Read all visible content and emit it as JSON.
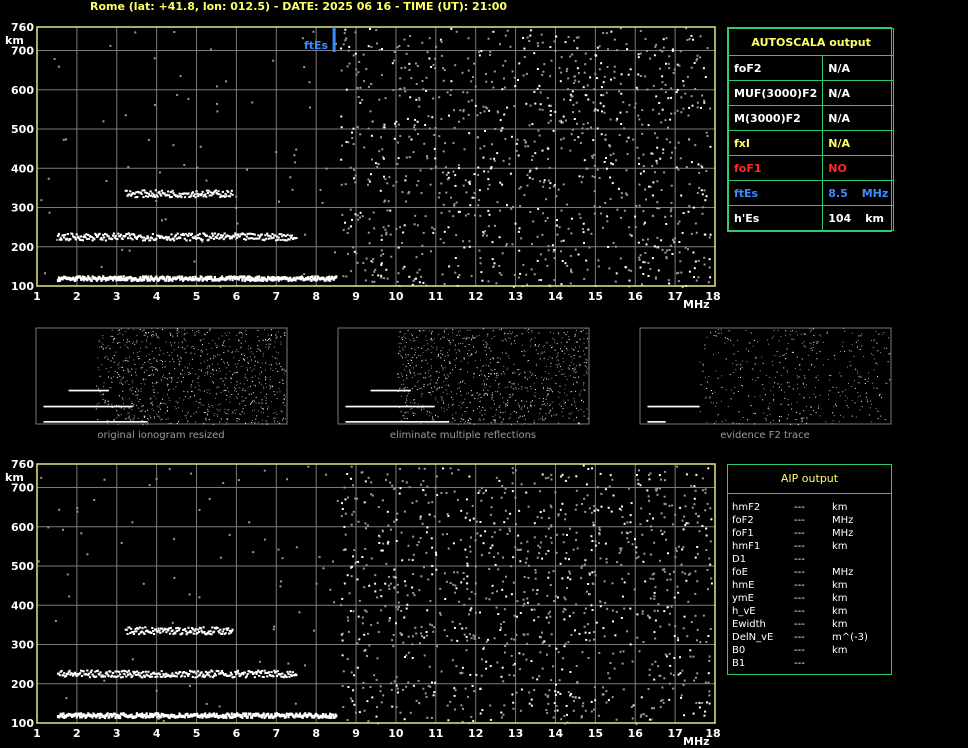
{
  "header": {
    "title": "Rome (lat: +41.8, lon: 012.5) - DATE: 2025 06 16 - TIME (UT): 21:00"
  },
  "colors": {
    "axis": "#e6e68a",
    "grid": "#7a7a7a",
    "table_border": "#2ecc71",
    "label_yellow": "#ffff66",
    "label_red": "#ff2a2a",
    "label_blue": "#3d8cff",
    "trace": "#ffffff",
    "noise": "#9a9a9a"
  },
  "autoscala": {
    "title": "AUTOSCALA output",
    "rows": [
      {
        "label": "foF2",
        "value": "N/A",
        "unit": "",
        "color": "#ffffff"
      },
      {
        "label": "MUF(3000)F2",
        "value": "N/A",
        "unit": "",
        "color": "#ffffff"
      },
      {
        "label": "M(3000)F2",
        "value": "N/A",
        "unit": "",
        "color": "#ffffff"
      },
      {
        "label": "fxI",
        "value": "N/A",
        "unit": "",
        "color": "#ffff66"
      },
      {
        "label": "foF1",
        "value": "NO",
        "unit": "",
        "color": "#ff2a2a"
      },
      {
        "label": "ftEs",
        "value": "8.5",
        "unit": "MHz",
        "color": "#3d8cff"
      },
      {
        "label": "h'Es",
        "value": "104",
        "unit": "km",
        "color": "#ffffff"
      }
    ]
  },
  "aip": {
    "title": "AIP output",
    "rows": [
      {
        "label": "hmF2",
        "value": "---",
        "unit": "km"
      },
      {
        "label": "foF2",
        "value": "---",
        "unit": "MHz"
      },
      {
        "label": "foF1",
        "value": "---",
        "unit": "MHz"
      },
      {
        "label": "hmF1",
        "value": "---",
        "unit": "km"
      },
      {
        "label": "D1",
        "value": "---",
        "unit": ""
      },
      {
        "label": "foE",
        "value": "---",
        "unit": "MHz"
      },
      {
        "label": "hmE",
        "value": "---",
        "unit": "km"
      },
      {
        "label": "ymE",
        "value": "---",
        "unit": "km"
      },
      {
        "label": "h_vE",
        "value": "---",
        "unit": "km"
      },
      {
        "label": "Ewidth",
        "value": "---",
        "unit": "km"
      },
      {
        "label": "DelN_vE",
        "value": "---",
        "unit": "m^(-3)"
      },
      {
        "label": "B0",
        "value": "---",
        "unit": "km"
      },
      {
        "label": "B1",
        "value": "---",
        "unit": ""
      }
    ]
  },
  "thumbnails": [
    {
      "caption": "original ionogram resized"
    },
    {
      "caption": "eliminate multiple reflections"
    },
    {
      "caption": "evidence F2 trace"
    }
  ],
  "chart_data": [
    {
      "type": "scatter",
      "title": "",
      "xlabel": "MHz",
      "ylabel": "km",
      "xlim": [
        1,
        18
      ],
      "ylim": [
        100,
        760
      ],
      "x_ticks": [
        1,
        2,
        3,
        4,
        5,
        6,
        7,
        8,
        9,
        10,
        11,
        12,
        13,
        14,
        15,
        16,
        17,
        18
      ],
      "y_ticks": [
        100,
        200,
        300,
        400,
        500,
        600,
        700,
        760
      ],
      "grid": true,
      "annotations": [
        {
          "text": "ftEs",
          "x": 8.5
        }
      ],
      "series": [
        {
          "x_range": [
            1.5,
            8.5
          ],
          "height": 120
        },
        {
          "x_range": [
            1.5,
            7.5
          ],
          "height": 225
        },
        {
          "x_range": [
            3.2,
            5.9
          ],
          "height": 335
        }
      ]
    },
    {
      "type": "scatter",
      "title": "",
      "xlabel": "MHz",
      "ylabel": "km",
      "xlim": [
        1,
        18
      ],
      "ylim": [
        100,
        760
      ],
      "x_ticks": [
        1,
        2,
        3,
        4,
        5,
        6,
        7,
        8,
        9,
        10,
        11,
        12,
        13,
        14,
        15,
        16,
        17,
        18
      ],
      "y_ticks": [
        100,
        200,
        300,
        400,
        500,
        600,
        700,
        760
      ],
      "grid": true,
      "series": [
        {
          "x_range": [
            1.5,
            8.5
          ],
          "height": 120
        },
        {
          "x_range": [
            1.5,
            7.5
          ],
          "height": 225
        },
        {
          "x_range": [
            3.2,
            5.9
          ],
          "height": 335
        }
      ]
    }
  ]
}
